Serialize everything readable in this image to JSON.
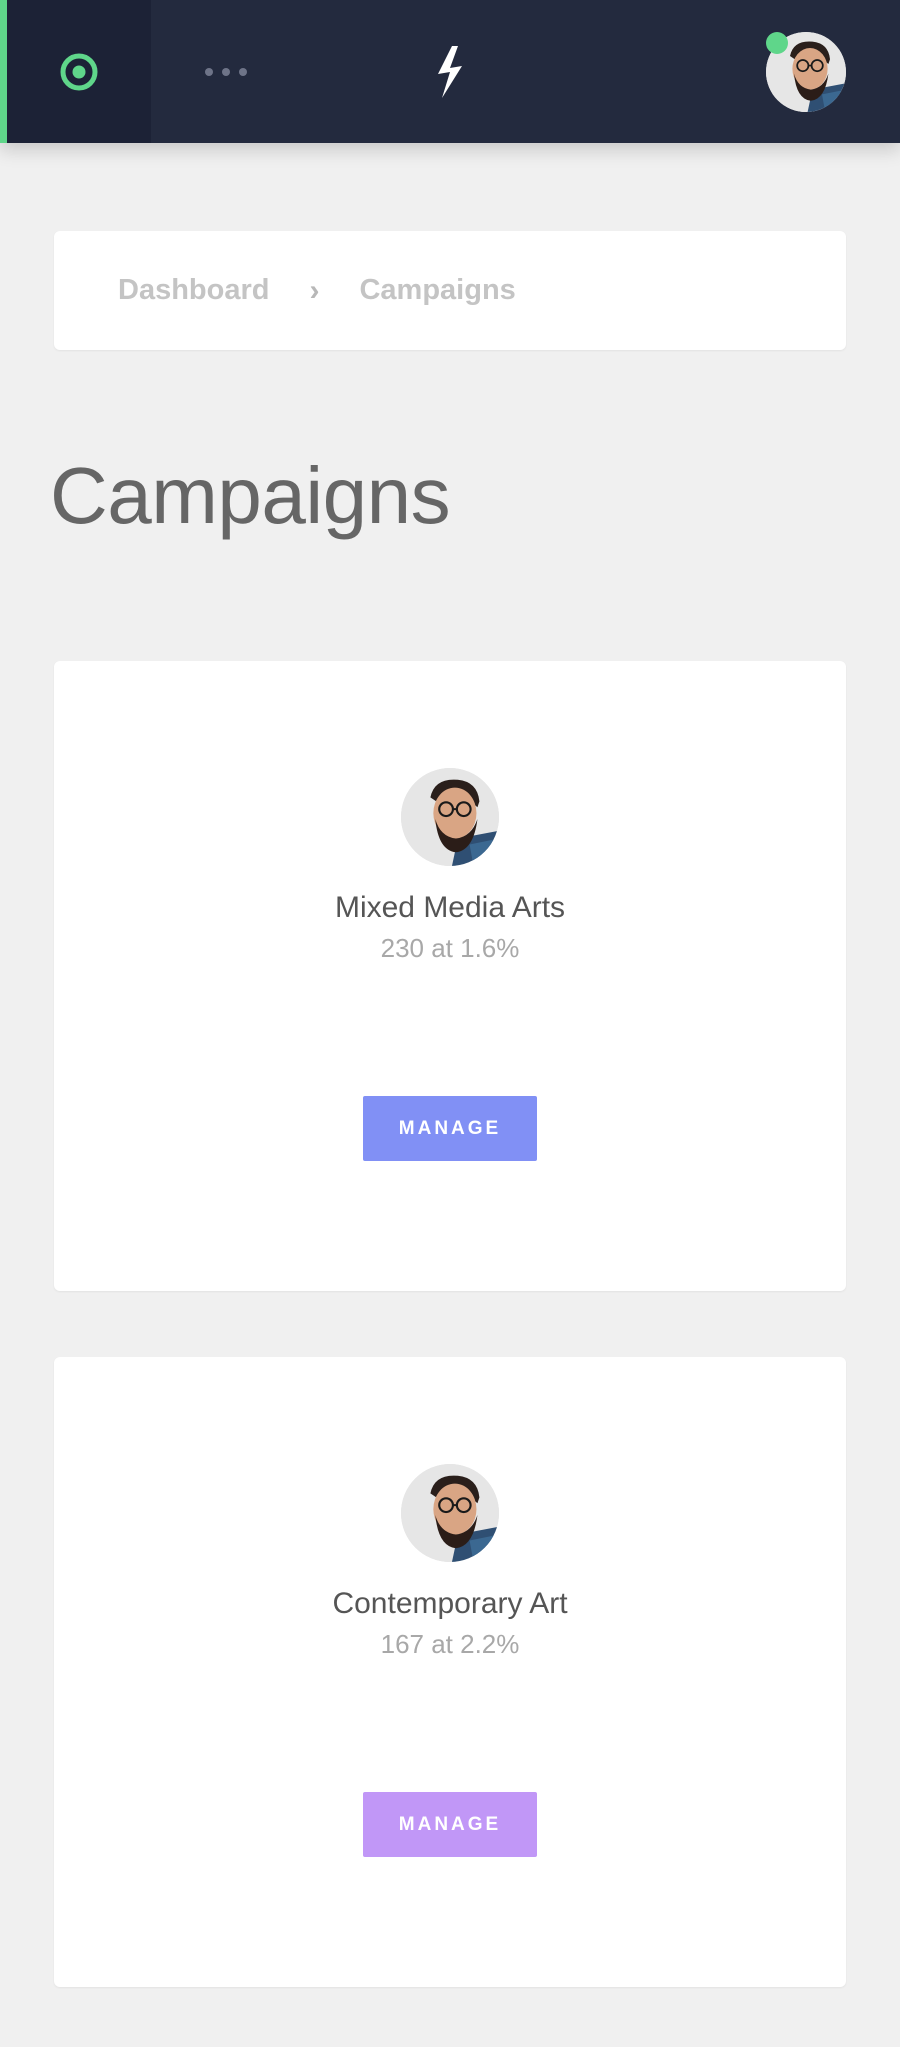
{
  "topbar": {
    "home_icon": "target-icon",
    "more_icon": "more-dots-icon",
    "logo_icon": "lightning-bolt-icon",
    "user_avatar": "user-avatar",
    "status": "online",
    "accent_color": "#5fd68a",
    "bg_color": "#232a3e"
  },
  "breadcrumb": {
    "items": [
      "Dashboard",
      "Campaigns"
    ],
    "separator": "›"
  },
  "page": {
    "title": "Campaigns"
  },
  "campaigns": [
    {
      "name": "Mixed Media Arts",
      "stats": "230 at 1.6%",
      "button_label": "MANAGE",
      "button_color": "#8190f5"
    },
    {
      "name": "Contemporary Art",
      "stats": "167 at 2.2%",
      "button_label": "MANAGE",
      "button_color": "#c197f7"
    }
  ]
}
